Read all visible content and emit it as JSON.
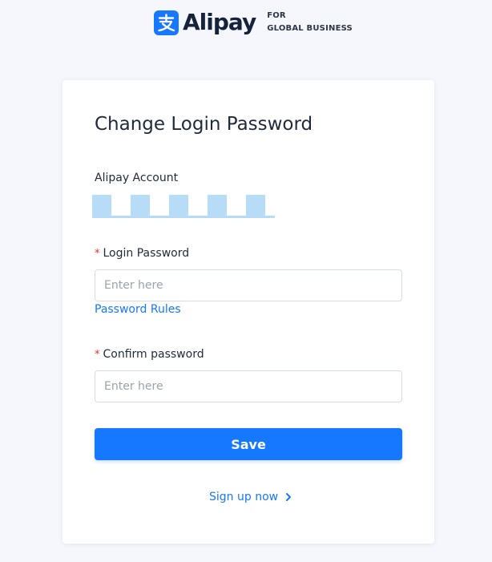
{
  "brand": {
    "name": "Alipay",
    "tagline_line1": "FOR",
    "tagline_line2": "GLOBAL BUSINESS",
    "accent_color": "#1677ff"
  },
  "form": {
    "title": "Change Login Password",
    "account": {
      "label": "Alipay Account",
      "value_masked": true
    },
    "login_password": {
      "required_mark": "*",
      "label": "Login Password",
      "placeholder": "Enter here",
      "value": ""
    },
    "password_rules_link": "Password Rules",
    "confirm_password": {
      "required_mark": "*",
      "label": "Confirm password",
      "placeholder": "Enter here",
      "value": ""
    },
    "save_label": "Save"
  },
  "footer": {
    "signup_label": "Sign up now",
    "signup_icon": "chevron-right-icon"
  }
}
